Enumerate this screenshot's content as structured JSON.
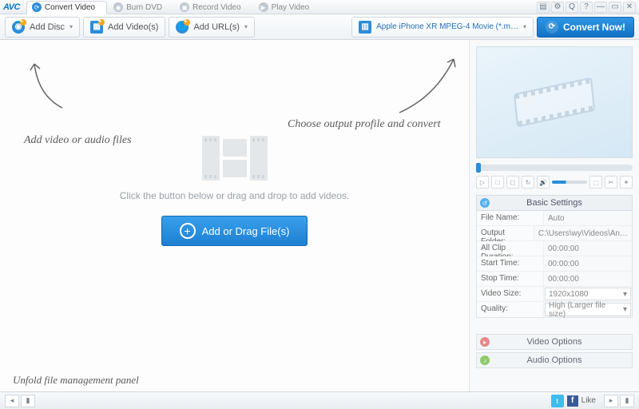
{
  "app": {
    "logo": "AVC"
  },
  "tabs": [
    {
      "label": "Convert Video",
      "active": true
    },
    {
      "label": "Burn DVD",
      "active": false
    },
    {
      "label": "Record Video",
      "active": false
    },
    {
      "label": "Play Video",
      "active": false
    }
  ],
  "toolbar": {
    "add_disc": "Add Disc",
    "add_videos": "Add Video(s)",
    "add_urls": "Add URL(s)",
    "profile": "Apple iPhone XR MPEG-4 Movie (*.m…",
    "convert": "Convert Now!"
  },
  "dropzone": {
    "hint": "Click the button below or drag and drop to add videos.",
    "button": "Add or Drag File(s)"
  },
  "settings": {
    "header": "Basic Settings",
    "rows": {
      "file_name": {
        "k": "File Name:",
        "v": "Auto"
      },
      "output_folder": {
        "k": "Output Folder:",
        "v": "C:\\Users\\wy\\Videos\\An…"
      },
      "all_clip": {
        "k": "All Clip Duration:",
        "v": "00:00:00"
      },
      "start": {
        "k": "Start Time:",
        "v": "00:00:00"
      },
      "stop": {
        "k": "Stop Time:",
        "v": "00:00:00"
      },
      "video_size": {
        "k": "Video Size:",
        "v": "1920x1080"
      },
      "quality": {
        "k": "Quality:",
        "v": "High (Larger file size)"
      }
    },
    "video_options": "Video Options",
    "audio_options": "Audio Options"
  },
  "social": {
    "like": "Like"
  },
  "annotations": {
    "a1": "Add video or audio files",
    "a2": "Choose output profile and convert",
    "a3": "Unfold file management panel"
  }
}
